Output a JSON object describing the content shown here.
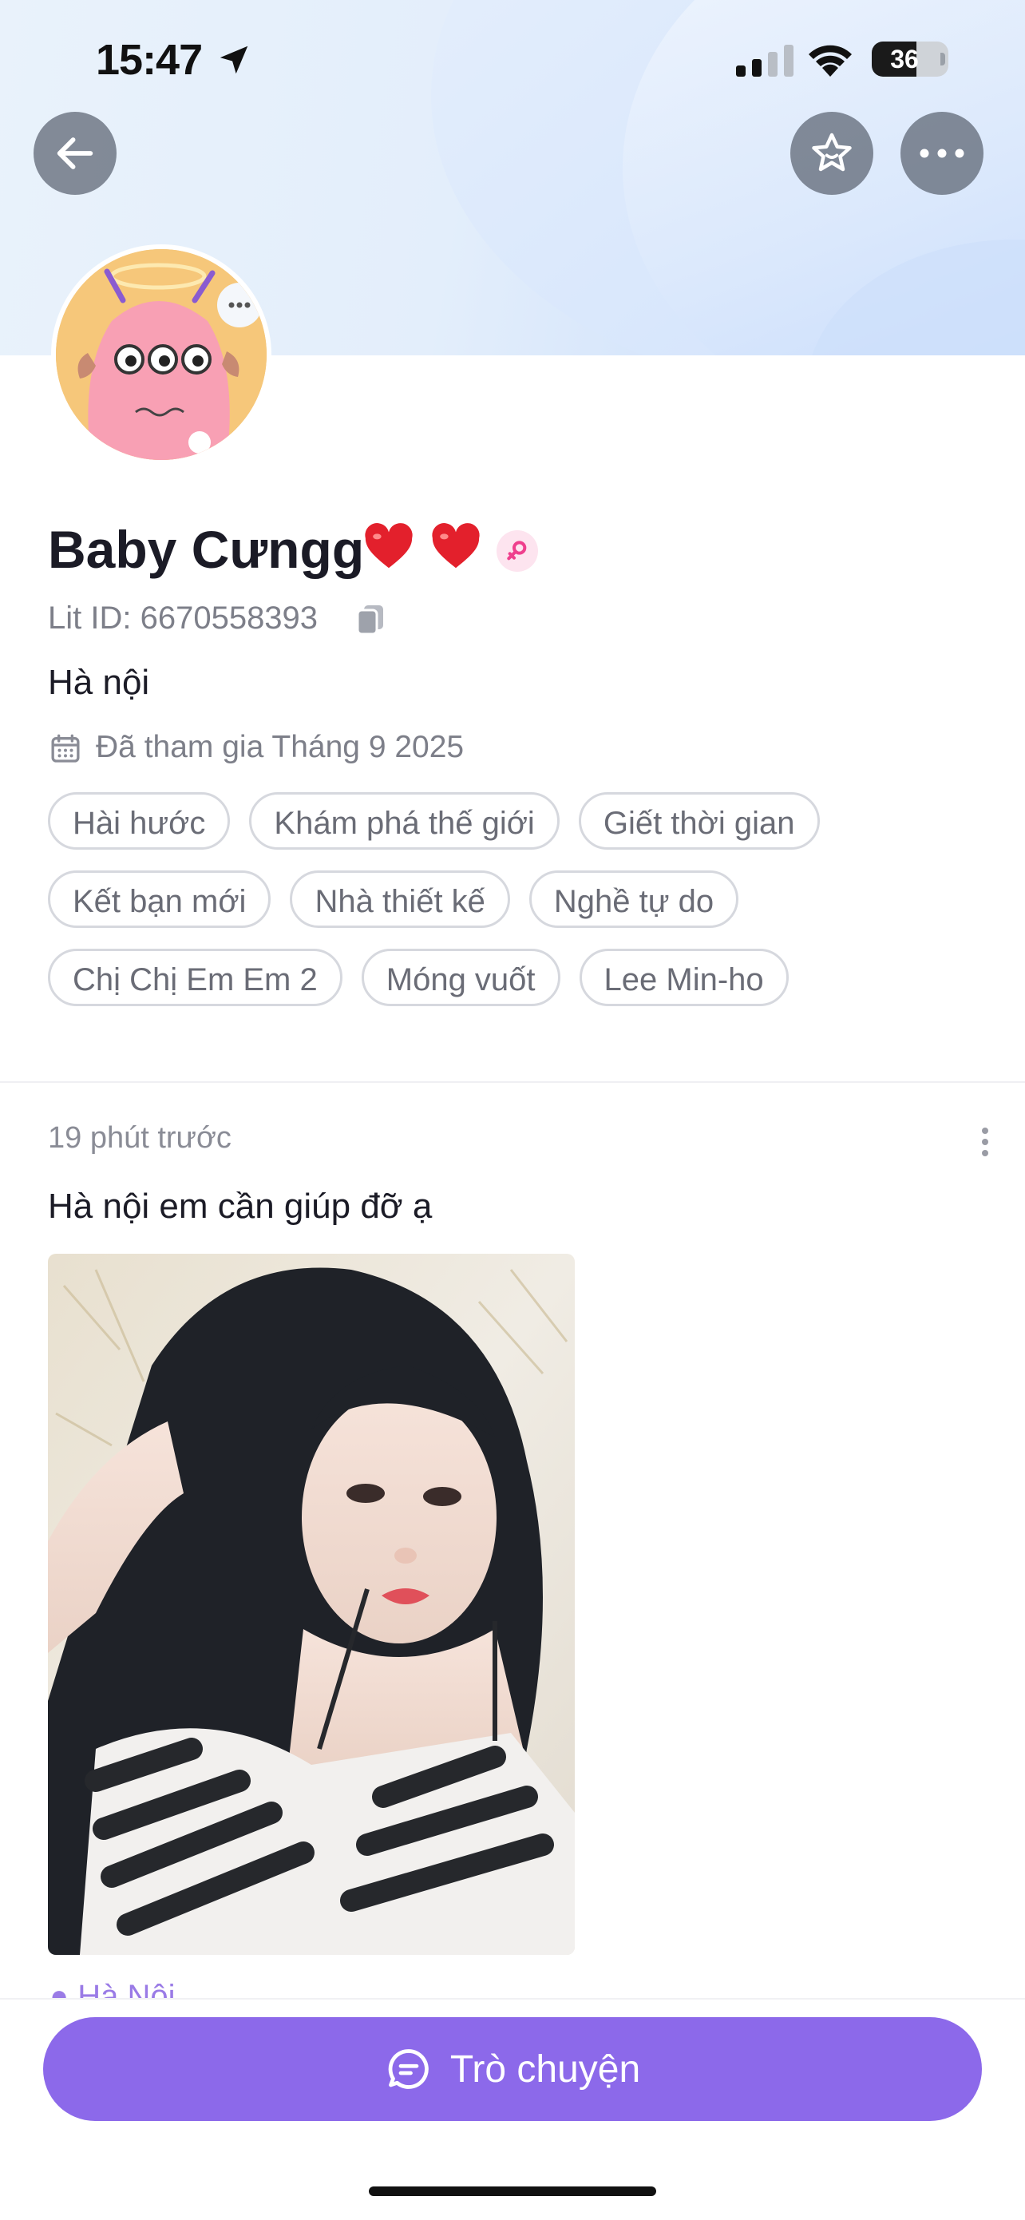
{
  "status_bar": {
    "time": "15:47",
    "battery_level": "36",
    "icons": [
      "location-arrow-icon",
      "cellular-signal-icon",
      "wifi-icon",
      "battery-icon"
    ]
  },
  "nav": {
    "icons": [
      "back-arrow-icon",
      "star-icon",
      "more-horizontal-icon"
    ]
  },
  "profile": {
    "name": "Baby Cưngg ❤️❤️",
    "name_text": "Baby Cưngg",
    "hearts": [
      "❤️",
      "❤️"
    ],
    "gender_icon": "female-symbol-icon",
    "lit_id": "Lit ID: 6670558393",
    "city": "Hà nội",
    "joined": "Đã tham gia Tháng 9 2025",
    "tags": [
      [
        "Hài hước",
        "Khám phá thế giới",
        "Giết thời gian"
      ],
      [
        "Kết bạn mới",
        "Nhà thiết kế",
        "Nghề tự do"
      ],
      [
        "Chị Chị Em Em 2",
        "Móng vuốt",
        "Lee Min-ho"
      ]
    ]
  },
  "post": {
    "time": "19 phút trước",
    "text": "Hà nội em cần giúp đỡ ạ",
    "location": "Hà Nội"
  },
  "chat_button": {
    "label": "Trò chuyện"
  },
  "colors": {
    "accent": "#8c69ea",
    "tag_border": "#d6d8de",
    "muted_text": "#7d7f89"
  }
}
